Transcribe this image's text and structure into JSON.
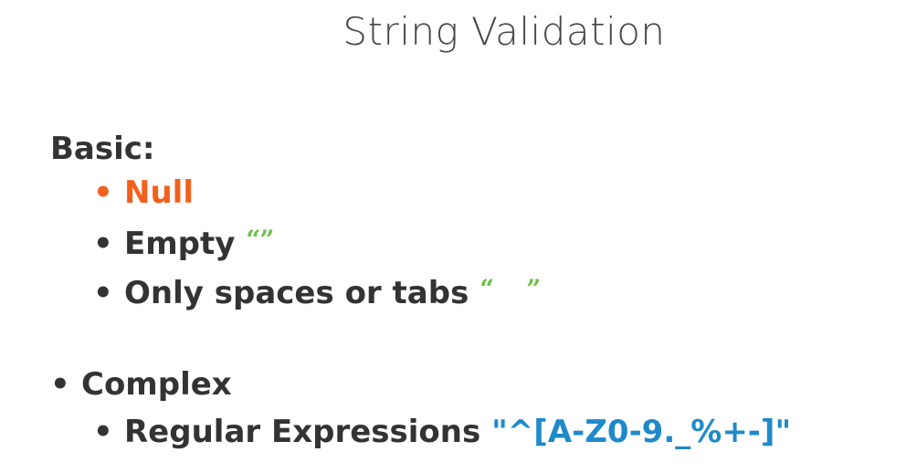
{
  "slide": {
    "title": "String Validation",
    "basic_heading": "Basic:",
    "basic_items": [
      {
        "bullet": "•",
        "label": "Null"
      },
      {
        "bullet": "•",
        "label": "Empty",
        "suffix": "“”"
      },
      {
        "bullet": "•",
        "label": "Only spaces or tabs",
        "suffix_open": "“",
        "suffix_close": "”"
      }
    ],
    "complex_item": {
      "bullet": "•",
      "label": "Complex"
    },
    "complex_subitem": {
      "bullet": "•",
      "label": "Regular Expressions",
      "regex": "\"^[A-Z0-9._%+-]\""
    }
  },
  "colors": {
    "accent_orange": "#f2601d",
    "accent_green": "#6cc04a",
    "accent_blue": "#1e8ac9",
    "text": "#333333"
  }
}
